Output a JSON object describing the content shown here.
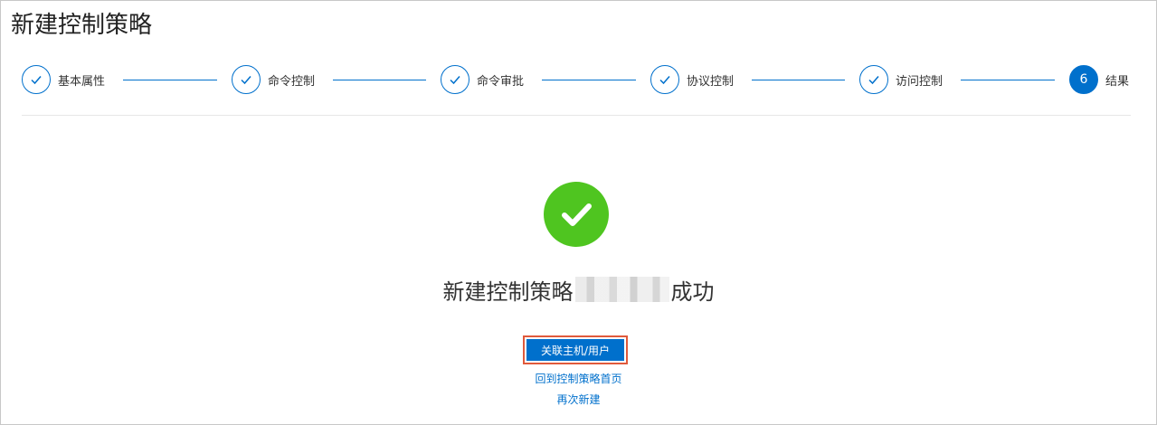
{
  "page": {
    "title": "新建控制策略"
  },
  "steps": [
    {
      "label": "基本属性",
      "state": "done",
      "icon": "check-icon"
    },
    {
      "label": "命令控制",
      "state": "done",
      "icon": "check-icon"
    },
    {
      "label": "命令审批",
      "state": "done",
      "icon": "check-icon"
    },
    {
      "label": "协议控制",
      "state": "done",
      "icon": "check-icon"
    },
    {
      "label": "访问控制",
      "state": "done",
      "icon": "check-icon"
    },
    {
      "label": "结果",
      "state": "current",
      "number": "6"
    }
  ],
  "result": {
    "prefix": "新建控制策略",
    "suffix": "成功",
    "icon": "success-check-icon"
  },
  "actions": {
    "primary_label": "关联主机/用户",
    "back_link": "回到控制策略首页",
    "new_link": "再次新建"
  },
  "colors": {
    "accent": "#0070cc",
    "success": "#4fc520",
    "highlight_border": "#e05a3c"
  }
}
